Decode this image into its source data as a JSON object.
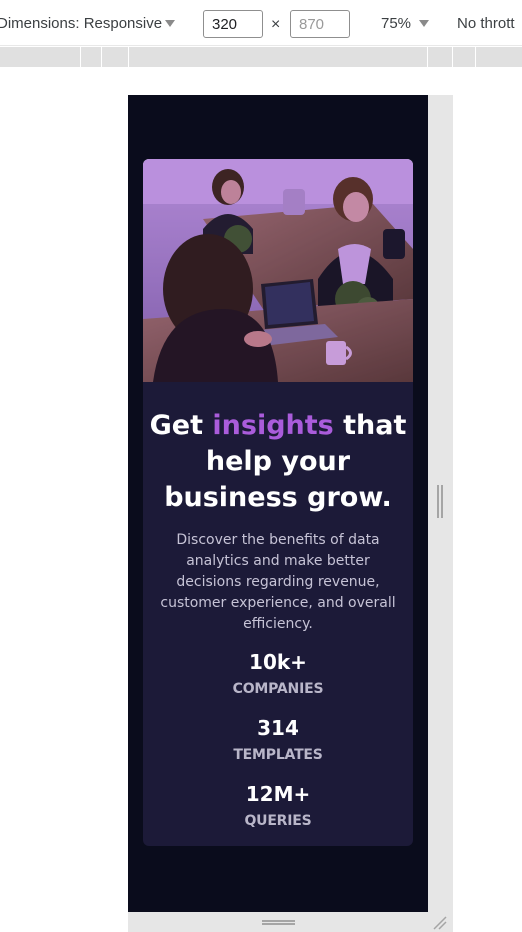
{
  "devtools": {
    "dimensions_label": "Dimensions: Responsive",
    "width_value": "320",
    "height_placeholder": "870",
    "times_symbol": "×",
    "zoom_label": "75%",
    "throttle_label": "No thrott"
  },
  "card": {
    "hero_image": "women-working-on-laptops-photo",
    "title_prefix": "Get ",
    "title_accent": "insights",
    "title_suffix": " that help your business grow.",
    "description": "Discover the benefits of data analytics and make better decisions regarding revenue, customer experience, and overall efficiency.",
    "stats": [
      {
        "value": "10k+",
        "label": "COMPANIES"
      },
      {
        "value": "314",
        "label": "TEMPLATES"
      },
      {
        "value": "12M+",
        "label": "QUERIES"
      }
    ]
  },
  "colors": {
    "page_bg": "#0a0c1c",
    "card_bg": "#1c1a38",
    "accent": "#aa5cdb",
    "text_main": "#ffffff",
    "text_muted": "#c6c3d6"
  },
  "icons": {
    "dimensions_dropdown": "triangle-down-icon",
    "zoom_dropdown": "triangle-down-icon",
    "resize_corner": "resize-corner-icon"
  }
}
